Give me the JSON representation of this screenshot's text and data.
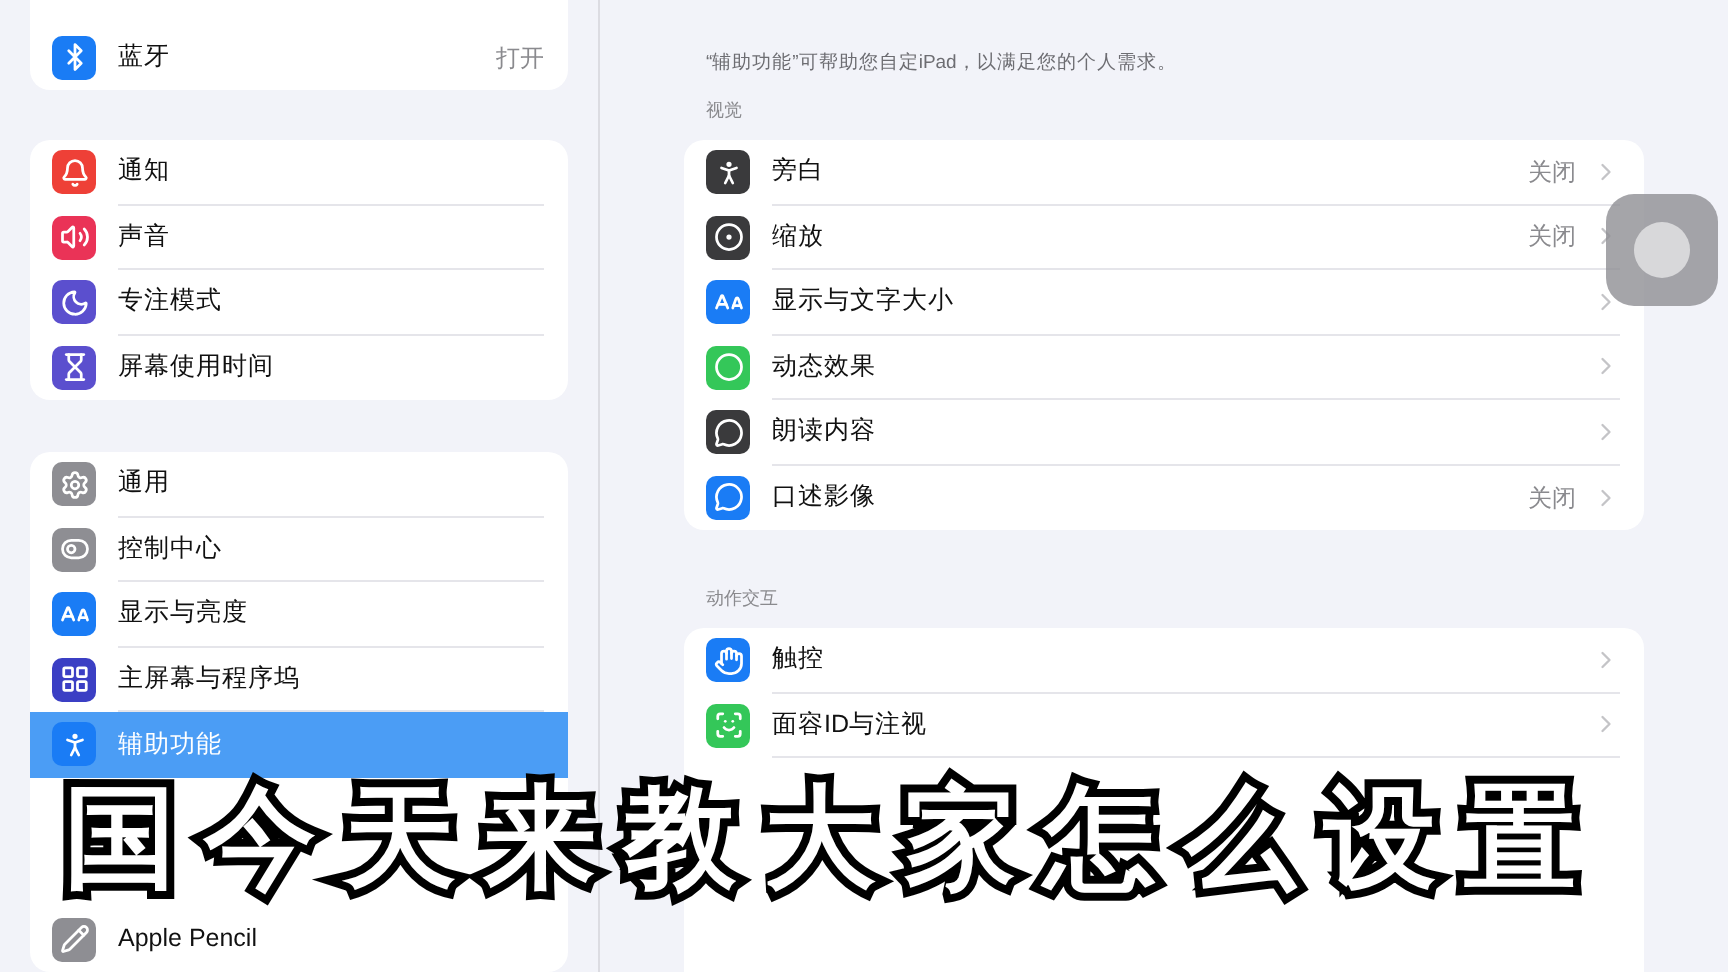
{
  "sidebar": {
    "groups": [
      {
        "items": [
          {
            "kind": "covered",
            "selected": false
          },
          {
            "kind": "row",
            "label": "蓝牙",
            "value": "打开",
            "selected": false
          }
        ]
      },
      {
        "items": [
          {
            "kind": "row",
            "label": "通知",
            "selected": false
          },
          {
            "kind": "row",
            "label": "声音",
            "selected": false
          },
          {
            "kind": "row",
            "label": "专注模式",
            "selected": false
          },
          {
            "kind": "row",
            "label": "屏幕使用时间",
            "selected": false
          }
        ]
      },
      {
        "items": [
          {
            "kind": "row",
            "label": "通用",
            "selected": false
          },
          {
            "kind": "row",
            "label": "控制中心",
            "selected": false
          },
          {
            "kind": "row",
            "label": "显示与亮度",
            "selected": false
          },
          {
            "kind": "row",
            "label": "主屏幕与程序坞",
            "selected": false
          },
          {
            "kind": "row",
            "label": "辅助功能",
            "selected": true
          },
          {
            "kind": "covered",
            "selected": false
          },
          {
            "kind": "covered",
            "selected": false
          },
          {
            "kind": "row",
            "label": "Apple Pencil",
            "selected": false
          }
        ]
      }
    ]
  },
  "content": {
    "note": "“辅助功能”可帮助您自定iPad，以满足您的个人需求。",
    "sections": [
      {
        "header": "视觉",
        "items": [
          {
            "kind": "row",
            "label": "旁白",
            "value": "关闭"
          },
          {
            "kind": "row",
            "label": "缩放",
            "value": "关闭"
          },
          {
            "kind": "row",
            "label": "显示与文字大小"
          },
          {
            "kind": "row",
            "label": "动态效果"
          },
          {
            "kind": "row",
            "label": "朗读内容"
          },
          {
            "kind": "row",
            "label": "口述影像",
            "value": "关闭"
          }
        ]
      },
      {
        "header": "动作交互",
        "items": [
          {
            "kind": "row",
            "label": "触控"
          },
          {
            "kind": "row",
            "label": "面容ID与注视"
          },
          {
            "kind": "covered"
          },
          {
            "kind": "covered"
          },
          {
            "kind": "covered"
          },
          {
            "kind": "covered"
          }
        ]
      }
    ]
  },
  "subtitle": "国今天来教大家怎么设置"
}
